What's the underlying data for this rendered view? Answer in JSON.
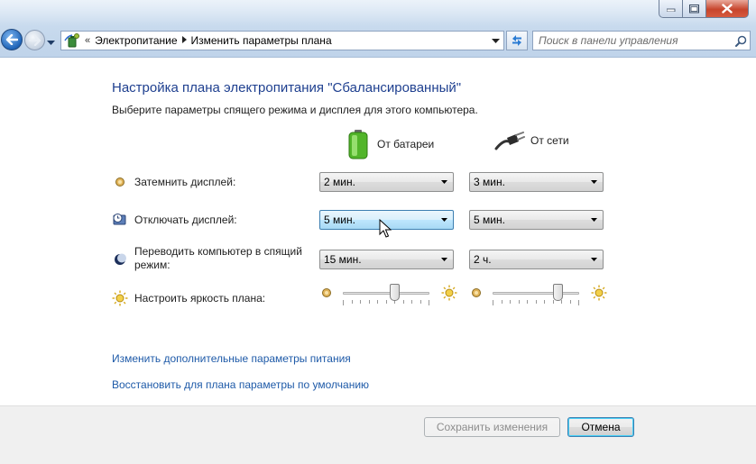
{
  "nav": {
    "breadcrumb": [
      "Электропитание",
      "Изменить параметры плана"
    ],
    "search_placeholder": "Поиск в панели управления"
  },
  "page": {
    "title": "Настройка плана электропитания \"Сбалансированный\"",
    "subtitle": "Выберите параметры спящего режима и дисплея для этого компьютера."
  },
  "columns": {
    "battery": "От батареи",
    "plugged": "От сети"
  },
  "settings": {
    "dim": {
      "label": "Затемнить дисплей:",
      "battery": "2 мин.",
      "plugged": "3 мин."
    },
    "display_off": {
      "label": "Отключать дисплей:",
      "battery": "5 мин.",
      "plugged": "5 мин."
    },
    "sleep": {
      "label_line1": "Переводить компьютер в спящий",
      "label_line2": "режим:",
      "battery": "15 мин.",
      "plugged": "2 ч."
    },
    "brightness": {
      "label": "Настроить яркость плана:",
      "battery_fraction": 0.6,
      "plugged_fraction": 0.75
    }
  },
  "links": {
    "advanced": "Изменить дополнительные параметры питания",
    "restore": "Восстановить для плана параметры по умолчанию"
  },
  "buttons": {
    "save": "Сохранить изменения",
    "cancel": "Отмена"
  },
  "colors": {
    "title": "#1e3f8f",
    "link": "#1e5aa8",
    "hover_select": "#bee6fd",
    "close_button": "#c7452c"
  }
}
